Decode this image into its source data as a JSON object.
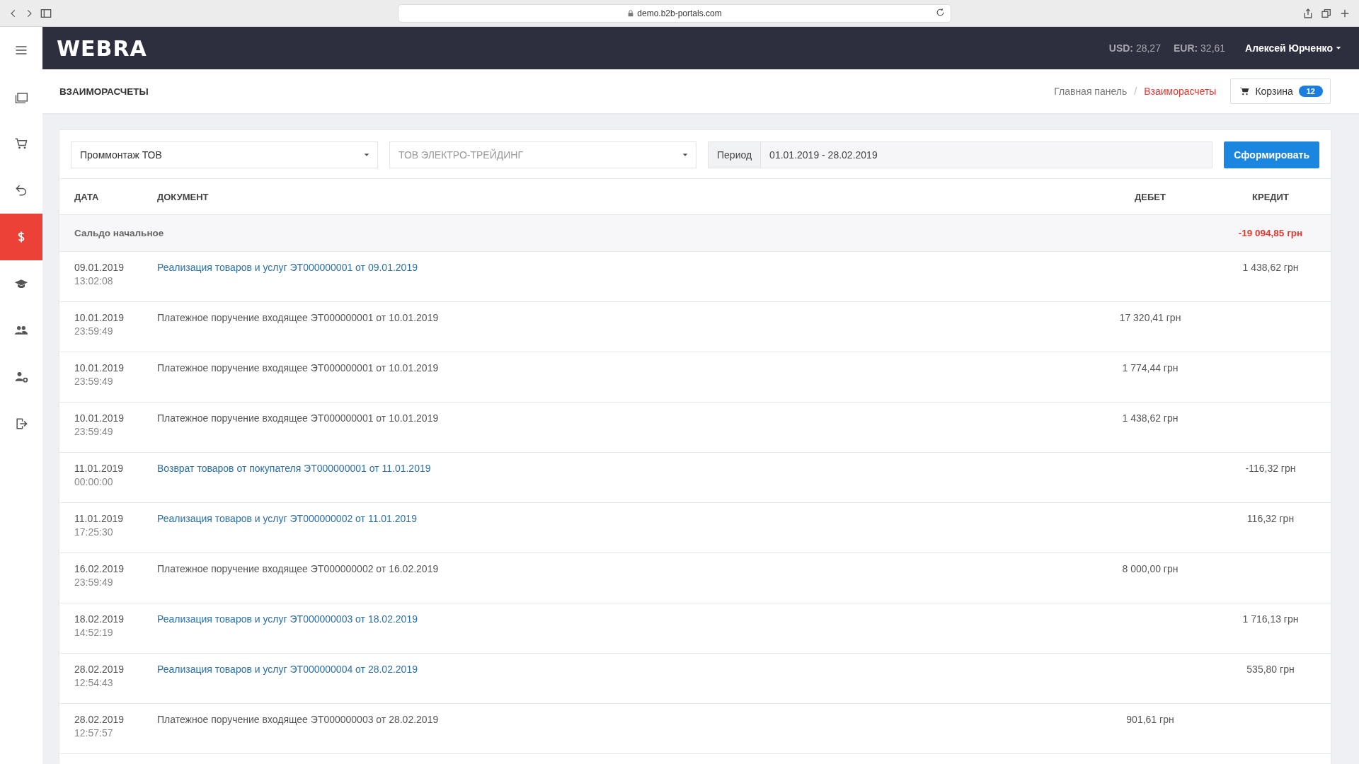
{
  "browser": {
    "url": "demo.b2b-portals.com"
  },
  "header": {
    "logo": "WEBRA",
    "rates": [
      {
        "code": "USD:",
        "value": "28,27"
      },
      {
        "code": "EUR:",
        "value": "32,61"
      }
    ],
    "user": "Алексей Юрченко"
  },
  "sidebar": {
    "items": [
      {
        "kind": "menu",
        "selected": false
      },
      {
        "kind": "folders",
        "selected": false
      },
      {
        "kind": "cart",
        "selected": false
      },
      {
        "kind": "return",
        "selected": false
      },
      {
        "kind": "dollar",
        "selected": true
      },
      {
        "kind": "education",
        "selected": false
      },
      {
        "kind": "people",
        "selected": false
      },
      {
        "kind": "user-settings",
        "selected": false
      },
      {
        "kind": "logout",
        "selected": false
      }
    ]
  },
  "page": {
    "title": "ВЗАИМОРАСЧЕТЫ",
    "breadcrumb_separator": "/",
    "breadcrumbs": [
      {
        "label": "Главная панель",
        "selected": false
      },
      {
        "label": "Взаиморасчеты",
        "selected": true
      }
    ],
    "cart": {
      "label": "Корзина",
      "count": "12"
    }
  },
  "filters": {
    "company": {
      "value": "Проммонтаж ТОВ"
    },
    "counterparty": {
      "placeholder": "ТОВ ЭЛЕКТРО-ТРЕЙДИНГ"
    },
    "period": {
      "label": "Период",
      "value": "01.01.2019 - 28.02.2019"
    },
    "submit": "Сформировать"
  },
  "table": {
    "columns": [
      "ДАТА",
      "ДОКУМЕНТ",
      "ДЕБЕТ",
      "КРЕДИТ"
    ],
    "opening_balance": {
      "label": "Сальдо начальное",
      "credit": "-19 094,85 грн"
    },
    "rows": [
      {
        "date": "09.01.2019",
        "time": "13:02:08",
        "document": "Реализация товаров и услуг ЭТ000000001 от 09.01.2019",
        "kind": "link",
        "debit": "",
        "credit": "1 438,62 грн"
      },
      {
        "date": "10.01.2019",
        "time": "23:59:49",
        "document": "Платежное поручение входящее ЭТ000000001 от 10.01.2019",
        "kind": "text",
        "debit": "17 320,41 грн",
        "credit": ""
      },
      {
        "date": "10.01.2019",
        "time": "23:59:49",
        "document": "Платежное поручение входящее ЭТ000000001 от 10.01.2019",
        "kind": "text",
        "debit": "1 774,44 грн",
        "credit": ""
      },
      {
        "date": "10.01.2019",
        "time": "23:59:49",
        "document": "Платежное поручение входящее ЭТ000000001 от 10.01.2019",
        "kind": "text",
        "debit": "1 438,62 грн",
        "credit": ""
      },
      {
        "date": "11.01.2019",
        "time": "00:00:00",
        "document": "Возврат товаров от покупателя ЭТ000000001 от 11.01.2019",
        "kind": "link",
        "debit": "",
        "credit": "-116,32 грн"
      },
      {
        "date": "11.01.2019",
        "time": "17:25:30",
        "document": "Реализация товаров и услуг ЭТ000000002 от 11.01.2019",
        "kind": "link",
        "debit": "",
        "credit": "116,32 грн"
      },
      {
        "date": "16.02.2019",
        "time": "23:59:49",
        "document": "Платежное поручение входящее ЭТ000000002 от 16.02.2019",
        "kind": "text",
        "debit": "8 000,00 грн",
        "credit": ""
      },
      {
        "date": "18.02.2019",
        "time": "14:52:19",
        "document": "Реализация товаров и услуг ЭТ000000003 от 18.02.2019",
        "kind": "link",
        "debit": "",
        "credit": "1 716,13 грн"
      },
      {
        "date": "28.02.2019",
        "time": "12:54:43",
        "document": "Реализация товаров и услуг ЭТ000000004 от 28.02.2019",
        "kind": "link",
        "debit": "",
        "credit": "535,80 грн"
      },
      {
        "date": "28.02.2019",
        "time": "12:57:57",
        "document": "Платежное поручение входящее ЭТ000000003 от 28.02.2019",
        "kind": "text",
        "debit": "901,61 грн",
        "credit": ""
      }
    ]
  }
}
